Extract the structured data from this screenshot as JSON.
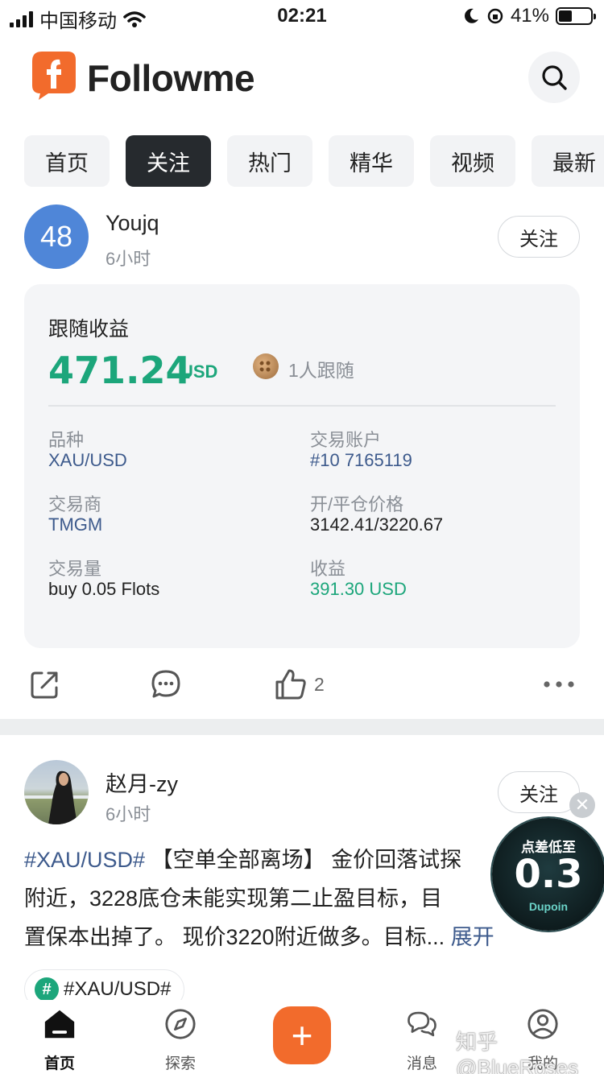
{
  "status_bar": {
    "carrier": "中国移动",
    "time": "02:21",
    "battery": "41%",
    "battery_level": 0.41
  },
  "header": {
    "app_name": "Followme"
  },
  "tabs": [
    {
      "label": "首页",
      "active": false
    },
    {
      "label": "关注",
      "active": true
    },
    {
      "label": "热门",
      "active": false
    },
    {
      "label": "精华",
      "active": false
    },
    {
      "label": "视频",
      "active": false
    },
    {
      "label": "最新",
      "active": false
    }
  ],
  "post1": {
    "avatar_text": "48",
    "username": "Youjq",
    "time": "6小时",
    "follow_label": "关注",
    "card": {
      "title": "跟随收益",
      "amount": "471.24",
      "unit": "USD",
      "followers": "1人跟随",
      "fields": {
        "symbol_label": "品种",
        "symbol": "XAU/USD",
        "account_label": "交易账户",
        "account": "#10 7165119",
        "broker_label": "交易商",
        "broker": "TMGM",
        "price_label": "开/平仓价格",
        "price": "3142.41/3220.67",
        "volume_label": "交易量",
        "volume": "buy 0.05 Flots",
        "profit_label": "收益",
        "profit": "391.30 USD"
      }
    },
    "likes": "2"
  },
  "post2": {
    "username": "赵月-zy",
    "time": "6小时",
    "follow_label": "关注",
    "tag": "#XAU/USD#",
    "text": " 【空单全部离场】 金价回落试探",
    "text_line2": "附近，3228底仓未能实现第二止盈目标，目",
    "text_line3": "置保本出掉了。 现价3220附近做多。目标...",
    "more": "展开",
    "topic": "#XAU/USD#"
  },
  "float_ad": {
    "line1": "点差低至",
    "value": "0.3",
    "brand": "Dupoin"
  },
  "bottom_nav": [
    {
      "label": "首页",
      "icon": "home-icon",
      "active": true
    },
    {
      "label": "探索",
      "icon": "compass-icon",
      "active": false
    },
    {
      "label": "消息",
      "icon": "chat-icon",
      "active": false
    },
    {
      "label": "我的",
      "icon": "profile-icon",
      "active": false
    }
  ],
  "watermark": "知乎 @BlueRoses",
  "colors": {
    "accent": "#f26b2c",
    "profit_green": "#1ca67b",
    "link_blue": "#3d5a8c",
    "active_tab": "#262a2e"
  }
}
